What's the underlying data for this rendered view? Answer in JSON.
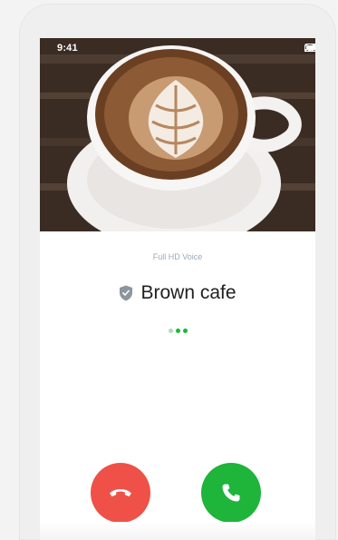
{
  "status_bar": {
    "time": "9:41",
    "icons": [
      "signal-icon",
      "wifi-icon",
      "battery-icon"
    ]
  },
  "call": {
    "voice_quality": "Full HD Voice",
    "caller_name": "Brown cafe",
    "caller_icon": "shield-icon",
    "status_dots": 3
  },
  "actions": {
    "decline_icon": "phone-hangup-icon",
    "accept_icon": "phone-icon"
  },
  "colors": {
    "decline": "#ef5148",
    "accept": "#1fb43a",
    "dots": "#19b83a"
  }
}
